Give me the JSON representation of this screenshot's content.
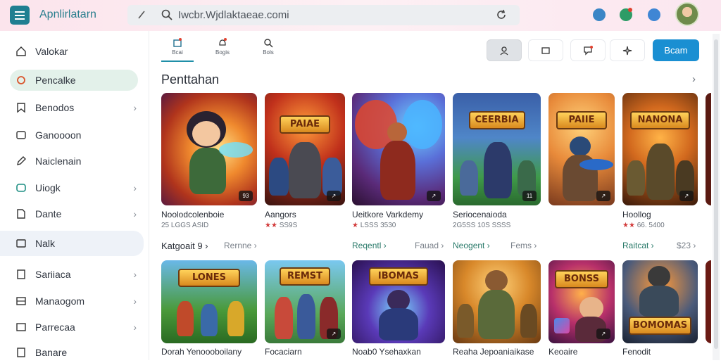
{
  "header": {
    "app_title": "Apnlirlatarn",
    "search_value": "Iwcbr.Wjdlaktaeae.comi"
  },
  "sidebar": {
    "items": [
      {
        "label": "Valokar",
        "icon": "home-icon",
        "chevron": false
      },
      {
        "label": "Pencalke",
        "icon": "game-icon",
        "chevron": false,
        "active": true
      },
      {
        "label": "Benodos",
        "icon": "bookmark-icon",
        "chevron": true
      },
      {
        "label": "Ganoooon",
        "icon": "folder-icon",
        "chevron": false
      },
      {
        "label": "Naiclenain",
        "icon": "pen-icon",
        "chevron": false
      },
      {
        "label": "Uiogk",
        "icon": "controller-icon",
        "chevron": true
      },
      {
        "label": "Dante",
        "icon": "file-icon",
        "chevron": true
      },
      {
        "label": "Nalk",
        "icon": "window-icon",
        "chevron": false,
        "hover": true
      },
      {
        "label": "Sariiaca",
        "icon": "document-icon",
        "chevron": true
      },
      {
        "label": "Manaogom",
        "icon": "list-icon",
        "chevron": true
      },
      {
        "label": "Parrecaa",
        "icon": "box-icon",
        "chevron": true
      },
      {
        "label": "Banare",
        "icon": "file-icon",
        "chevron": false
      }
    ]
  },
  "tabs": [
    {
      "label": "Bcai",
      "icon": "store-icon"
    },
    {
      "label": "Bogis",
      "icon": "bell-icon"
    },
    {
      "label": "Bols",
      "icon": "search-icon"
    }
  ],
  "primary_button": "Bcam",
  "section": {
    "title": "Penttahan",
    "more": "›"
  },
  "row1": [
    {
      "title": "Noolodcolenboie",
      "meta": "25 LGGS  ASID",
      "badge": "93",
      "banner": ""
    },
    {
      "title": "Aangors",
      "meta_red": "★★ ",
      "meta": "SS9S",
      "badge": "↗",
      "banner": "PAIAE"
    },
    {
      "title": "Ueitkore Varkdemy",
      "meta_red": "★ ",
      "meta": "LSSS 3530",
      "badge": "↗",
      "banner": ""
    },
    {
      "title": "Seriocenaioda",
      "meta": "2G5SS  10S SSSS",
      "badge": "11",
      "banner": "CEERBIA"
    },
    {
      "title": "",
      "meta": "",
      "badge": "↗",
      "banner": "PAIIE"
    },
    {
      "title": "Hoollog",
      "meta_red": "★★ ",
      "meta": "66.  5400",
      "badge": "↗",
      "banner": "NANONA"
    }
  ],
  "row_labels": [
    {
      "text": "Katgoait 9 ›",
      "extra": "Rernne ›"
    },
    {
      "text": "Reqentl ›",
      "extra": "Fauad ›"
    },
    {
      "text": "Neogent ›",
      "extra": "Fems ›"
    },
    {
      "text": "Raitcat ›",
      "extra": "$23 ›"
    }
  ],
  "row2": [
    {
      "title": "Dorah Yenoooboilany",
      "banner": "LONES",
      "badge": ""
    },
    {
      "title": "Focaciarn",
      "banner": "REMST",
      "badge": "↗"
    },
    {
      "title": "Noab0 Ysehaxkan",
      "banner": "IBOMAS",
      "badge": ""
    },
    {
      "title": "Reaha  Jepoaniaikase",
      "banner": "",
      "badge": ""
    },
    {
      "title": "Keoaire",
      "banner": "BONSS",
      "badge": "↗"
    },
    {
      "title": "Fenodit",
      "banner": "BOMOMAS",
      "badge": ""
    }
  ]
}
